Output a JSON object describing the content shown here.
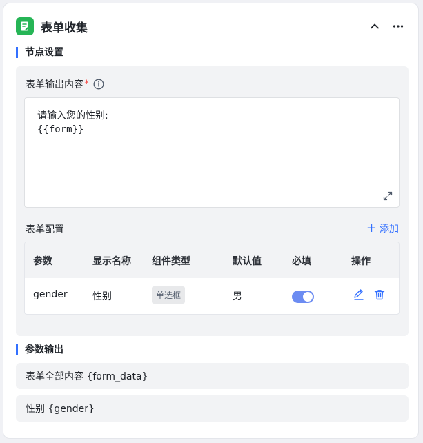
{
  "header": {
    "title": "表单收集",
    "brand_color": "#26b556"
  },
  "node_settings": {
    "section_title": "节点设置",
    "output_label": "表单输出内容",
    "required_mark": "*",
    "textarea_line1": "请输入您的性别:",
    "textarea_line2": "{{form}}"
  },
  "form_config": {
    "label": "表单配置",
    "add_label": "添加",
    "columns": [
      "参数",
      "显示名称",
      "组件类型",
      "默认值",
      "必填",
      "操作"
    ],
    "rows": [
      {
        "param": "gender",
        "display_name": "性别",
        "component_type": "单选框",
        "default_value": "男",
        "required": true
      }
    ]
  },
  "param_output": {
    "section_title": "参数输出",
    "items": [
      "表单全部内容 {form_data}",
      "性别 {gender}"
    ]
  },
  "colors": {
    "accent": "#3370ff",
    "toggle_on": "#6c8cf2",
    "panel_bg": "#f2f3f5"
  }
}
